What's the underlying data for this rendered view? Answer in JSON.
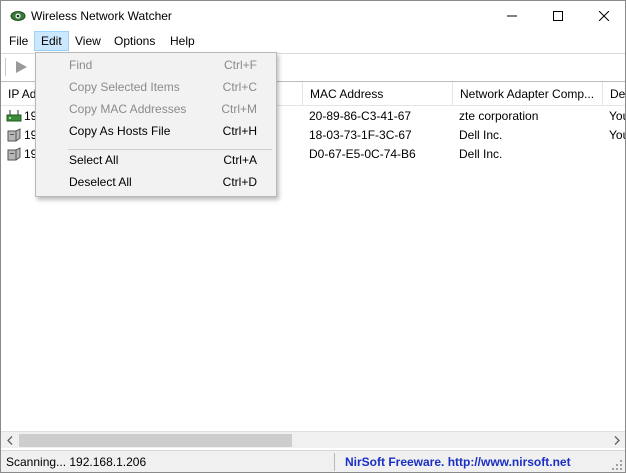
{
  "window": {
    "title": "Wireless Network Watcher",
    "app_icon": "eye-network-icon",
    "controls": [
      "minimize-icon",
      "maximize-icon",
      "close-icon"
    ]
  },
  "menubar": {
    "items": [
      {
        "label": "File"
      },
      {
        "label": "Edit",
        "active": true
      },
      {
        "label": "View"
      },
      {
        "label": "Options"
      },
      {
        "label": "Help"
      }
    ]
  },
  "toolbar": {
    "play_icon": "play-icon"
  },
  "edit_menu": {
    "items": [
      {
        "label": "Find",
        "shortcut": "Ctrl+F",
        "enabled": false
      },
      {
        "label": "Copy Selected Items",
        "shortcut": "Ctrl+C",
        "enabled": false
      },
      {
        "label": "Copy MAC Addresses",
        "shortcut": "Ctrl+M",
        "enabled": false
      },
      {
        "label": "Copy As Hosts File",
        "shortcut": "Ctrl+H",
        "enabled": true
      },
      {
        "label": "Select All",
        "shortcut": "Ctrl+A",
        "enabled": true
      },
      {
        "label": "Deselect All",
        "shortcut": "Ctrl+D",
        "enabled": true
      }
    ]
  },
  "list": {
    "columns": [
      "IP Ad",
      "MAC Address",
      "Network Adapter Comp...",
      "Dev"
    ],
    "rows": [
      {
        "ip": "19",
        "mac": "20-89-86-C3-41-67",
        "vendor": "zte corporation",
        "device": "You",
        "icon": "router-icon"
      },
      {
        "ip": "19",
        "mac": "18-03-73-1F-3C-67",
        "vendor": "Dell Inc.",
        "device": "You",
        "icon": "computer-icon"
      },
      {
        "ip": "19",
        "mac": "D0-67-E5-0C-74-B6",
        "vendor": "Dell Inc.",
        "device": "",
        "icon": "computer-icon"
      }
    ]
  },
  "statusbar": {
    "status_text": "Scanning... 192.168.1.206",
    "link_text": "NirSoft Freeware.  http://www.nirsoft.net",
    "link_color": "#1a2fc4"
  }
}
